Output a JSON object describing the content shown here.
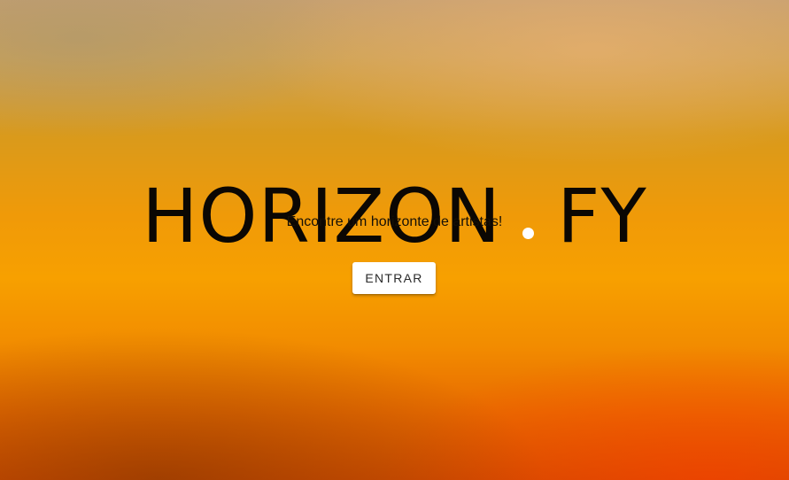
{
  "hero": {
    "brand_left": "HORIZON",
    "brand_right": "FY",
    "brand_dot_color": "#ffffff",
    "tagline": "Encontre um horizonte de artistas!",
    "enter_label": "ENTRAR"
  },
  "colors": {
    "background_top": "#c6a070",
    "background_mid": "#f7a000",
    "background_bottom": "#d34e00",
    "text": "#0b0703",
    "button_bg": "#ffffff"
  }
}
